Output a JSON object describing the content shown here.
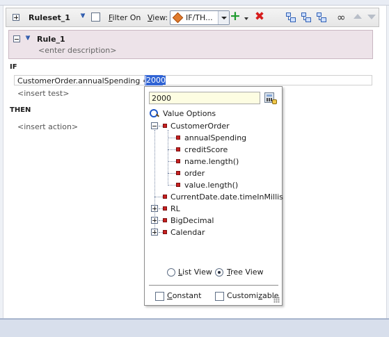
{
  "ruleset": {
    "title": "Ruleset_1",
    "filter_label": "Filter On",
    "view_label": "View:",
    "view_value": "IF/TH..."
  },
  "rule": {
    "title": "Rule_1",
    "description_placeholder": "<enter description>"
  },
  "if_section": {
    "label": "IF",
    "expression": "CustomerOrder.annualSpending  ==",
    "value": "2000",
    "insert_test_placeholder": "<insert test>"
  },
  "then_section": {
    "label": "THEN",
    "insert_action_placeholder": "<insert action>"
  },
  "popup": {
    "input_value": "2000",
    "value_options_label": "Value Options",
    "tree": {
      "customer_order": "CustomerOrder",
      "annual_spending": "annualSpending",
      "credit_score": "creditScore",
      "name_length": "name.length()",
      "order": "order",
      "value_length": "value.length()",
      "current_date": "CurrentDate.date.timeInMillis",
      "rl": "RL",
      "big_decimal": "BigDecimal",
      "calendar": "Calendar"
    },
    "list_view_label": "List View",
    "tree_view_label": "Tree View",
    "selected_view": "Tree View",
    "constant_label": "Constant",
    "customizable_label": "Customizable"
  },
  "colors": {
    "rule_panel_bg": "#ede3e9",
    "popup_input_bg": "#fdfde2",
    "selection": "#2f63d4",
    "add_icon": "#1e9b2d",
    "delete_icon": "#d61c1c"
  }
}
